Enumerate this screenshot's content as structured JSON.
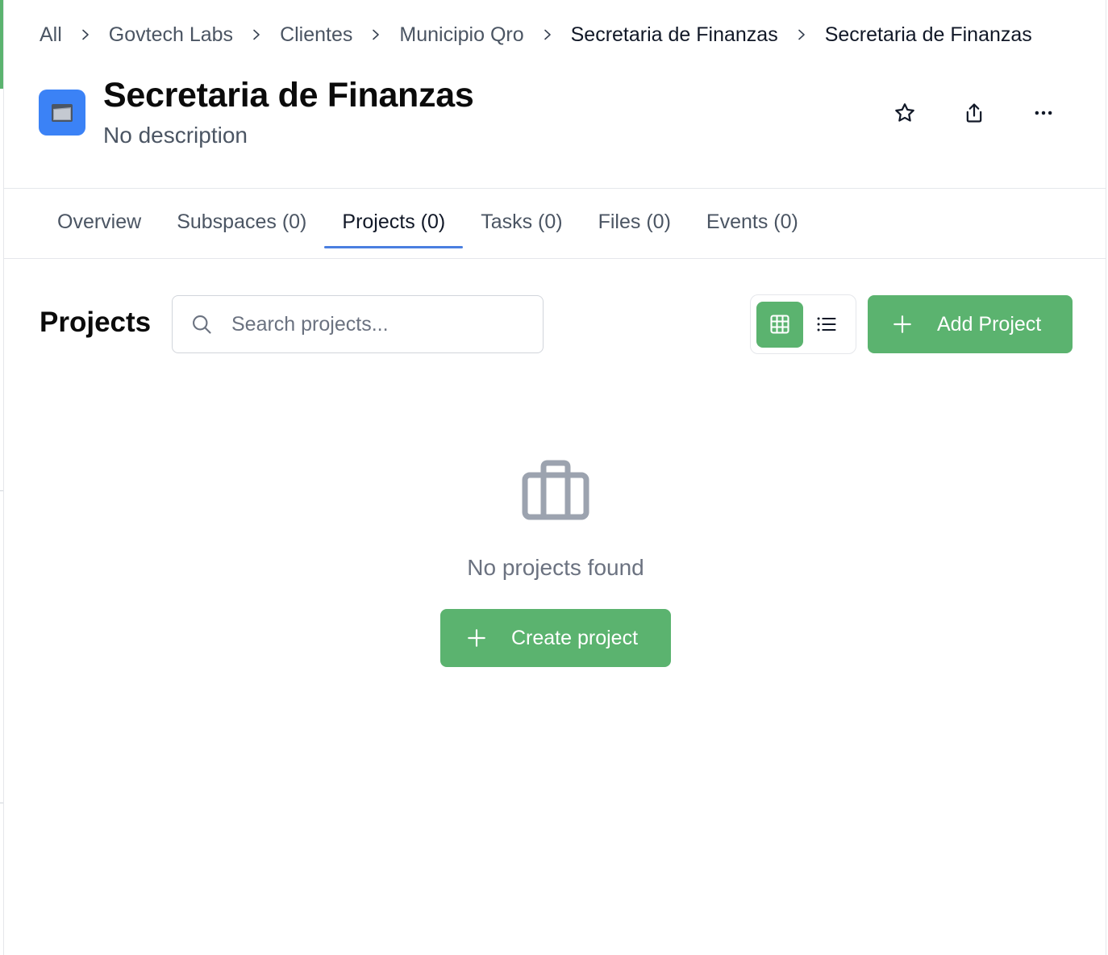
{
  "breadcrumb": {
    "items": [
      "All",
      "Govtech Labs",
      "Clientes",
      "Municipio Qro",
      "Secretaria de Finanzas",
      "Secretaria de Finanzas"
    ]
  },
  "header": {
    "title": "Secretaria de Finanzas",
    "description": "No description",
    "icon": "folder-icon",
    "actions": [
      "star-icon",
      "share-icon",
      "more-icon"
    ]
  },
  "tabs": [
    {
      "label": "Overview"
    },
    {
      "label": "Subspaces (0)"
    },
    {
      "label": "Projects (0)",
      "active": true
    },
    {
      "label": "Tasks (0)"
    },
    {
      "label": "Files (0)"
    },
    {
      "label": "Events (0)"
    }
  ],
  "projects": {
    "title": "Projects",
    "search_placeholder": "Search projects...",
    "view_mode": "grid",
    "add_label": "Add Project",
    "empty_text": "No projects found",
    "create_label": "Create project"
  },
  "colors": {
    "accent_green": "#5bb36f",
    "tab_underline": "#4a7fe0",
    "space_icon_bg": "#3b82f6"
  }
}
